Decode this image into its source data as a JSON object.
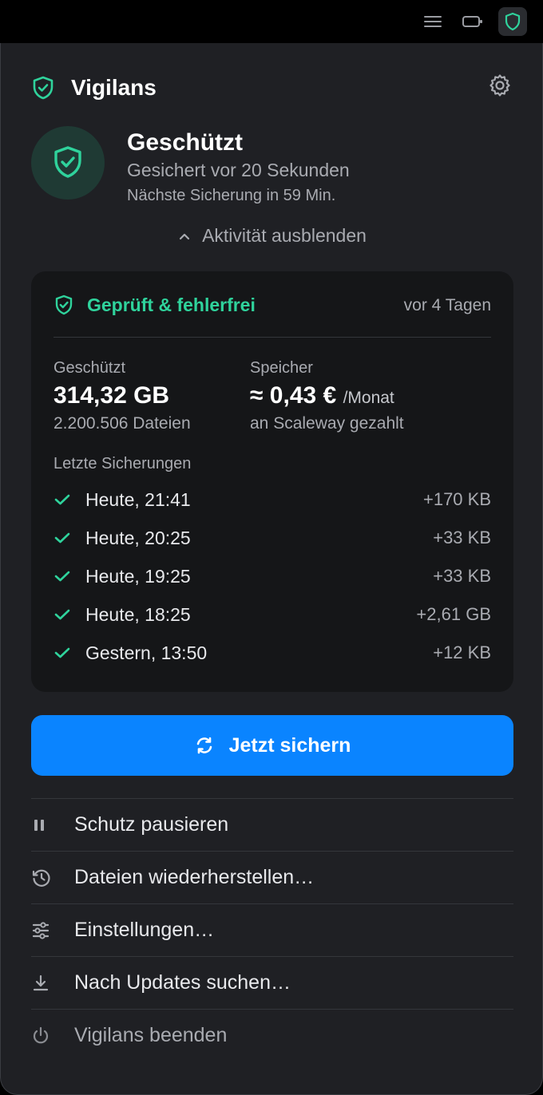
{
  "menubar": {
    "icons": [
      "menu-lines-icon",
      "battery-icon",
      "vigilans-shield-icon"
    ]
  },
  "header": {
    "app_name": "Vigilans",
    "settings_icon": "gear-icon"
  },
  "status": {
    "title": "Geschützt",
    "last_backup": "Gesichert vor 20 Sekunden",
    "next_backup": "Nächste Sicherung in 59 Min."
  },
  "activity_toggle": {
    "label": "Aktivität ausblenden"
  },
  "activity_card": {
    "verified_label": "Geprüft & fehlerfrei",
    "verified_ago": "vor 4 Tagen",
    "protected": {
      "label": "Geschützt",
      "value": "314,32 GB",
      "files": "2.200.506 Dateien"
    },
    "storage": {
      "label": "Speicher",
      "value": "≈ 0,43 €",
      "unit": "/Monat",
      "provider": "an Scaleway gezahlt"
    },
    "recent_label": "Letzte Sicherungen",
    "recent": [
      {
        "when": "Heute, 21:41",
        "delta": "+170 KB"
      },
      {
        "when": "Heute, 20:25",
        "delta": "+33 KB"
      },
      {
        "when": "Heute, 19:25",
        "delta": "+33 KB"
      },
      {
        "when": "Heute, 18:25",
        "delta": "+2,61 GB"
      },
      {
        "when": "Gestern, 13:50",
        "delta": "+12 KB"
      }
    ]
  },
  "primary_action": {
    "label": "Jetzt sichern"
  },
  "menu": [
    {
      "label": "Schutz pausieren",
      "icon": "pause-icon"
    },
    {
      "label": "Dateien wiederherstellen…",
      "icon": "history-clock-icon"
    },
    {
      "label": "Einstellungen…",
      "icon": "sliders-icon"
    },
    {
      "label": "Nach Updates suchen…",
      "icon": "download-icon"
    },
    {
      "label": "Vigilans beenden",
      "icon": "power-icon"
    }
  ],
  "colors": {
    "accent_green": "#2fd39c",
    "primary_blue": "#0a84ff",
    "panel_bg": "#1f2024",
    "card_bg": "#151618"
  }
}
